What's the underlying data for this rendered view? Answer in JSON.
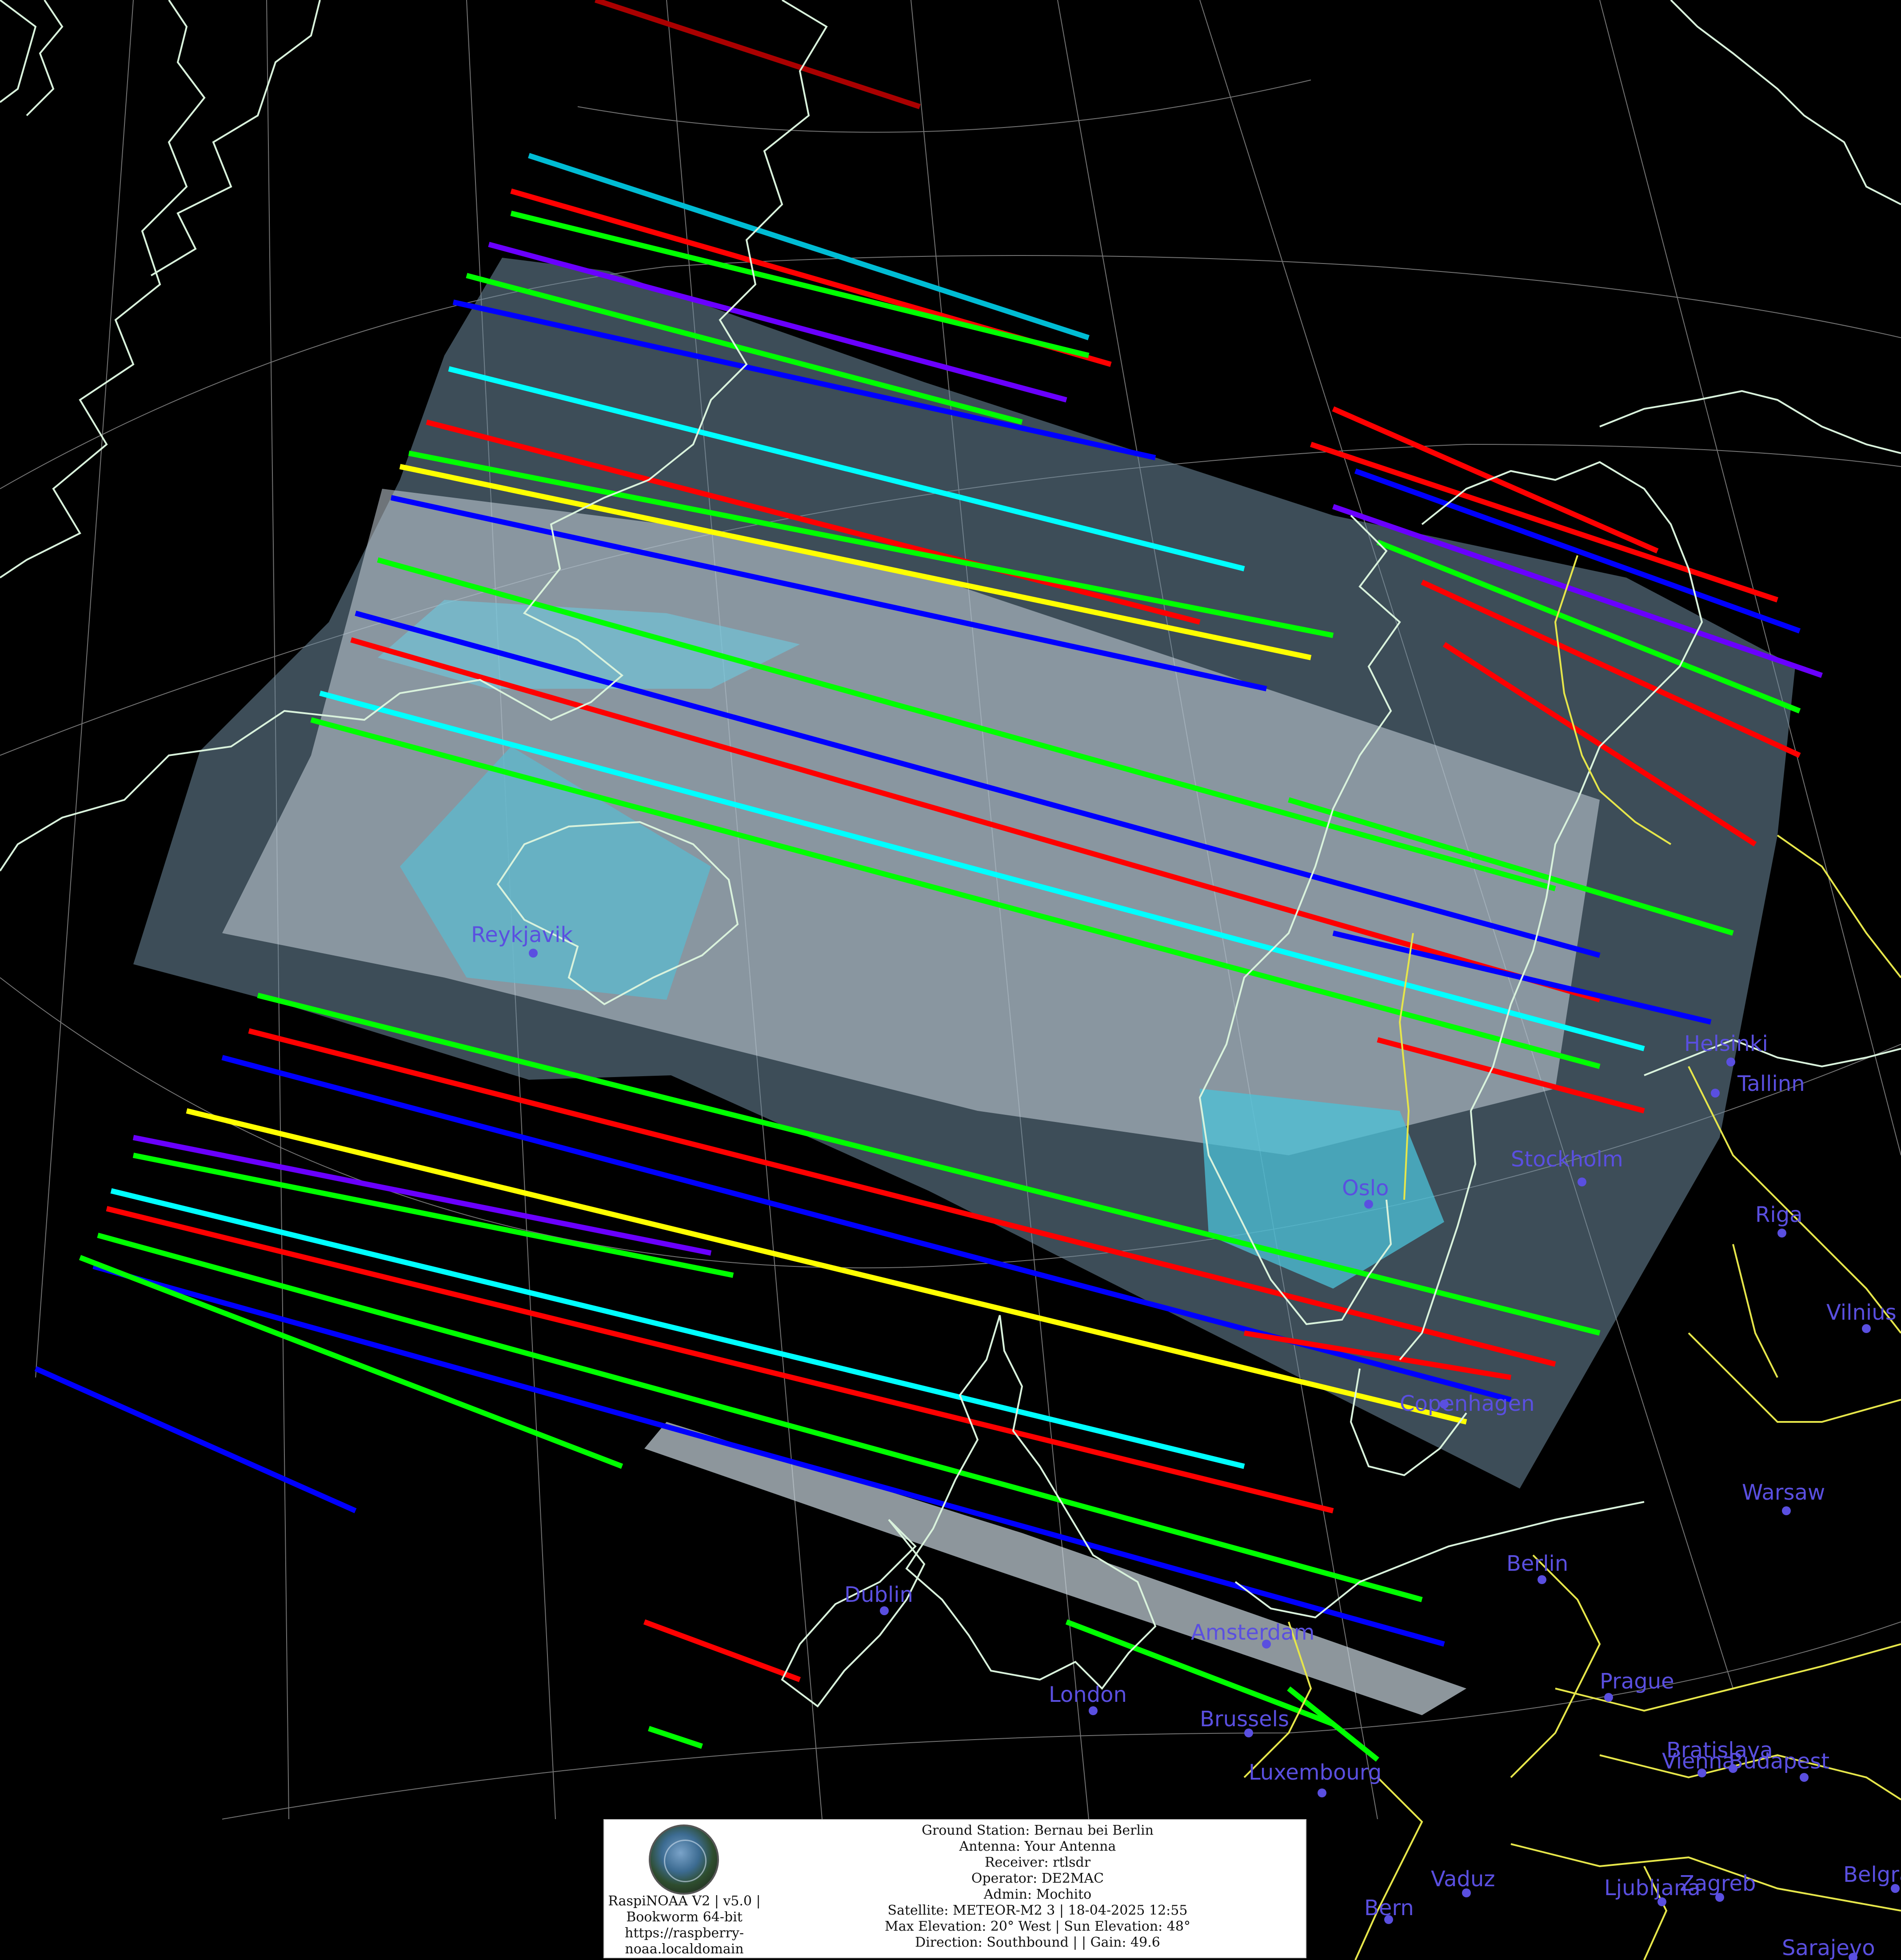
{
  "map": {
    "background": "#000000",
    "coastline_color": "#d9f2dc",
    "border_color": "#e6e64a",
    "graticule_color": "#b0b0b0",
    "city_color": "#5a4fe0",
    "cities": [
      {
        "name": "Reykjavik"
      },
      {
        "name": "Oslo"
      },
      {
        "name": "Stockholm"
      },
      {
        "name": "Helsinki"
      },
      {
        "name": "Tallinn"
      },
      {
        "name": "Riga"
      },
      {
        "name": "Vilnius"
      },
      {
        "name": "Copenhagen"
      },
      {
        "name": "Warsaw"
      },
      {
        "name": "Berlin"
      },
      {
        "name": "Dublin"
      },
      {
        "name": "Amsterdam"
      },
      {
        "name": "London"
      },
      {
        "name": "Brussels"
      },
      {
        "name": "Prague"
      },
      {
        "name": "Luxembourg"
      },
      {
        "name": "Bratislava"
      },
      {
        "name": "Vienna"
      },
      {
        "name": "Budapest"
      },
      {
        "name": "Vaduz"
      },
      {
        "name": "Bern"
      },
      {
        "name": "Ljubljana"
      },
      {
        "name": "Zagreb"
      },
      {
        "name": "Belgrade"
      },
      {
        "name": "Sarajevo"
      }
    ]
  },
  "footer": {
    "logo_icon": "raspinoaa-logo-icon",
    "left_lines": [
      "RaspiNOAA V2 | v5.0 |",
      "Bookworm 64-bit",
      "https://raspberry-",
      "noaa.localdomain"
    ],
    "right_lines": [
      "Ground Station: Bernau bei Berlin",
      "Antenna: Your Antenna",
      "Receiver: rtlsdr",
      "Operator: DE2MAC",
      "Admin: Mochito",
      "Satellite: METEOR-M2 3 | 18-04-2025 12:55",
      "Max Elevation: 20° West | Sun Elevation: 48°",
      "Direction: Southbound | | Gain: 49.6"
    ]
  }
}
